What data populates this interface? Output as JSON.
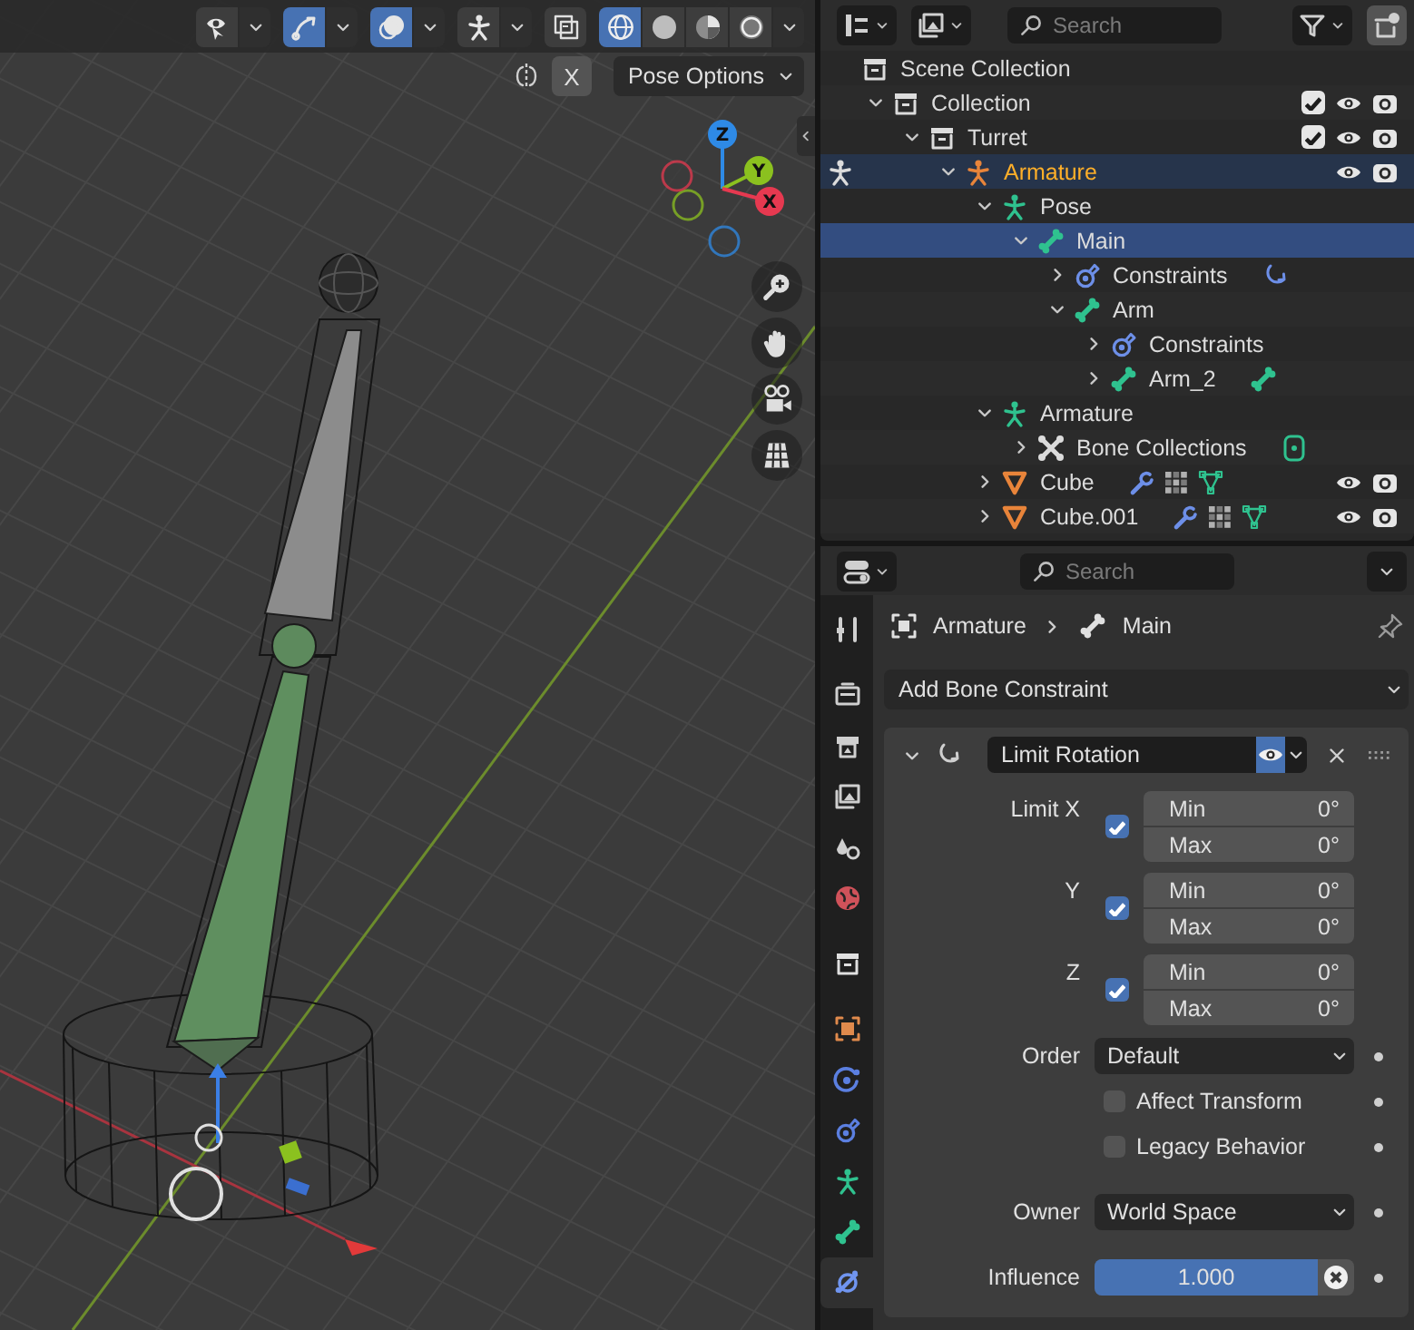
{
  "viewport": {
    "header_tools": [
      {
        "kind": "visibility",
        "active": false
      },
      {
        "kind": "gizmo",
        "active": true
      },
      {
        "kind": "overlay",
        "active": true
      },
      {
        "kind": "pose",
        "active": false
      }
    ],
    "xray": {
      "on": false
    },
    "shading": [
      {
        "kind": "wireframe",
        "selected": true
      },
      {
        "kind": "solid",
        "selected": false
      },
      {
        "kind": "material",
        "selected": false
      },
      {
        "kind": "rendered",
        "selected": false
      }
    ],
    "mirror_toggle": {
      "label": "X",
      "on": false
    },
    "pose_options": "Pose Options",
    "axes": [
      {
        "label": "Z",
        "color": "#2e8ae6"
      },
      {
        "label": "Y",
        "color": "#8bc11f"
      },
      {
        "label": "X",
        "color": "#e63950"
      }
    ],
    "nav_buttons": [
      {
        "kind": "zoom"
      },
      {
        "kind": "pan"
      },
      {
        "kind": "camera"
      },
      {
        "kind": "ortho"
      }
    ]
  },
  "outliner": {
    "search": {
      "placeholder": "Search"
    },
    "tree": [
      {
        "label": "Scene Collection",
        "kind": "scene-collection",
        "selected": false,
        "active": false,
        "children": [
          {
            "label": "Collection",
            "kind": "collection",
            "selected": false,
            "active": false,
            "expanded": true,
            "checked": true,
            "visible": true,
            "children": [
              {
                "label": "Turret",
                "kind": "collection",
                "selected": false,
                "active": false,
                "expanded": true,
                "checked": true,
                "visible": true,
                "children": [
                  {
                    "label": "Armature",
                    "kind": "armature-object",
                    "selected": true,
                    "active": true,
                    "expanded": true,
                    "visible": true,
                    "children": [
                      {
                        "label": "Pose",
                        "kind": "pose",
                        "selected": false,
                        "active": false,
                        "expanded": true,
                        "children": [
                          {
                            "label": "Main",
                            "kind": "bone",
                            "selected": true,
                            "active": false,
                            "expanded": true,
                            "children": [
                              {
                                "label": "Constraints",
                                "kind": "constraints",
                                "selected": false,
                                "active": false,
                                "expanded": false,
                                "extras": [
                                  {
                                    "kind": "constraint"
                                  }
                                ]
                              },
                              {
                                "label": "Arm",
                                "kind": "bone",
                                "selected": false,
                                "active": false,
                                "expanded": true,
                                "children": [
                                  {
                                    "label": "Constraints",
                                    "kind": "constraints",
                                    "selected": false,
                                    "active": false,
                                    "expanded": false
                                  },
                                  {
                                    "label": "Arm_2",
                                    "kind": "bone",
                                    "selected": false,
                                    "active": false,
                                    "expanded": false,
                                    "extras": [
                                      {
                                        "kind": "bone"
                                      }
                                    ]
                                  }
                                ]
                              }
                            ]
                          }
                        ]
                      },
                      {
                        "label": "Armature",
                        "kind": "armature-data",
                        "selected": false,
                        "active": false,
                        "expanded": true,
                        "children": [
                          {
                            "label": "Bone Collections",
                            "kind": "bone-collections",
                            "selected": false,
                            "active": false,
                            "expanded": false,
                            "extras": [
                              {
                                "kind": "bone-group"
                              }
                            ]
                          }
                        ]
                      },
                      {
                        "label": "Cube",
                        "kind": "mesh",
                        "selected": false,
                        "active": false,
                        "expanded": false,
                        "visible": true,
                        "extras": [
                          {
                            "kind": "modifier"
                          },
                          {
                            "kind": "particles"
                          },
                          {
                            "kind": "mesh"
                          }
                        ]
                      },
                      {
                        "label": "Cube.001",
                        "kind": "mesh",
                        "selected": false,
                        "active": false,
                        "expanded": false,
                        "visible": true,
                        "extras": [
                          {
                            "kind": "modifier"
                          },
                          {
                            "kind": "particles"
                          },
                          {
                            "kind": "mesh"
                          }
                        ]
                      }
                    ]
                  }
                ]
              }
            ]
          }
        ]
      }
    ]
  },
  "properties": {
    "search": {
      "placeholder": "Search"
    },
    "tab_groups": [
      [
        {
          "kind": "tool",
          "selected": false
        }
      ],
      [
        {
          "kind": "render",
          "selected": false
        },
        {
          "kind": "output",
          "selected": false
        },
        {
          "kind": "view-layer",
          "selected": false
        },
        {
          "kind": "scene",
          "selected": false
        },
        {
          "kind": "world",
          "selected": false
        }
      ],
      [
        {
          "kind": "collection",
          "selected": false
        }
      ],
      [
        {
          "kind": "object",
          "selected": false
        },
        {
          "kind": "physics",
          "selected": false
        },
        {
          "kind": "object-constraint",
          "selected": false
        },
        {
          "kind": "armature",
          "selected": false
        },
        {
          "kind": "bone",
          "selected": false
        },
        {
          "kind": "bone-constraint",
          "selected": true
        }
      ]
    ],
    "breadcrumb": [
      {
        "kind": "object",
        "label": "Armature"
      },
      {
        "kind": "bone",
        "label": "Main"
      }
    ],
    "add_menu": "Add Bone Constraint",
    "constraint": {
      "name": "Limit Rotation",
      "expanded": true,
      "enabled": true,
      "limits": [
        {
          "label": "Limit X",
          "checked": true,
          "min_label": "Min",
          "min": "0°",
          "max_label": "Max",
          "max": "0°"
        },
        {
          "label": "Y",
          "checked": true,
          "min_label": "Min",
          "min": "0°",
          "max_label": "Max",
          "max": "0°"
        },
        {
          "label": "Z",
          "checked": true,
          "min_label": "Min",
          "min": "0°",
          "max_label": "Max",
          "max": "0°"
        }
      ],
      "order": {
        "label": "Order",
        "value": "Default"
      },
      "options": [
        {
          "label": "Affect Transform",
          "checked": false
        },
        {
          "label": "Legacy Behavior",
          "checked": false
        }
      ],
      "owner": {
        "label": "Owner",
        "value": "World Space"
      },
      "influence": {
        "label": "Influence",
        "value": "1.000",
        "level": 1
      }
    }
  }
}
